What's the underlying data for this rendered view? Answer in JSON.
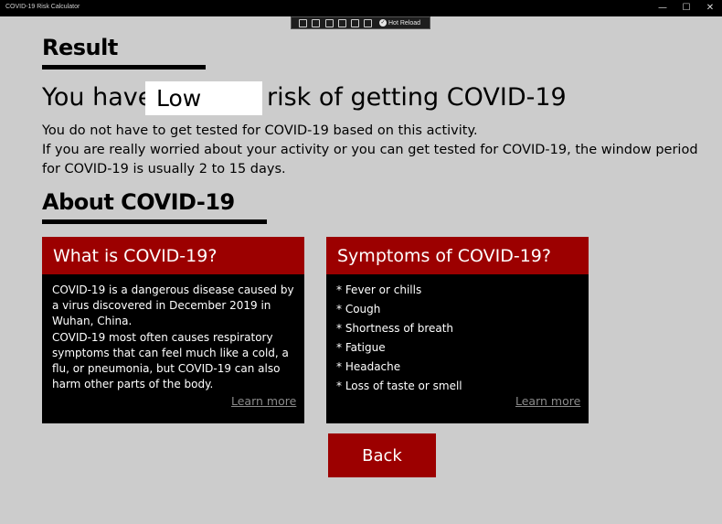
{
  "window": {
    "title": "COVID-19 Risk Calculator",
    "minimize_glyph": "—",
    "maximize_glyph": "☐",
    "close_glyph": "✕"
  },
  "debug_toolbar": {
    "hot_reload_label": "Hot Reload",
    "icons": [
      "live-visual-tree-icon",
      "select-element-icon",
      "display-layout-adorners-icon",
      "track-focus-icon",
      "binding-failures-icon",
      "accessibility-icon"
    ]
  },
  "result": {
    "heading": "Result",
    "risk_prefix": "You have",
    "risk_level": "Low",
    "risk_suffix": "risk of getting COVID-19",
    "line1": "You do not have to get tested for COVID-19 based on this activity.",
    "line2": "If you are really worried about your activity or you can get tested for COVID-19, the window period for COVID-19 is usually 2 to 15 days."
  },
  "about": {
    "heading": "About COVID-19",
    "what_card": {
      "title": "What is COVID-19?",
      "paragraphs": [
        "COVID-19 is a dangerous disease caused by a virus discovered in December 2019 in Wuhan, China.",
        "COVID-19 most often causes respiratory symptoms that can feel much like a cold, a flu, or pneumonia, but COVID-19 can also harm other parts of the body."
      ],
      "learn_more": "Learn more"
    },
    "symptoms_card": {
      "title": "Symptoms of COVID-19?",
      "items": [
        "* Fever or chills",
        "* Cough",
        "* Shortness of breath",
        "* Fatigue",
        "* Headache",
        "* Loss of taste or smell"
      ],
      "learn_more": "Learn more"
    }
  },
  "back_button": "Back",
  "colors": {
    "background": "#cccccc",
    "accent": "#9c0000",
    "card_background": "#000000",
    "link_gray": "#8a8a8a"
  }
}
